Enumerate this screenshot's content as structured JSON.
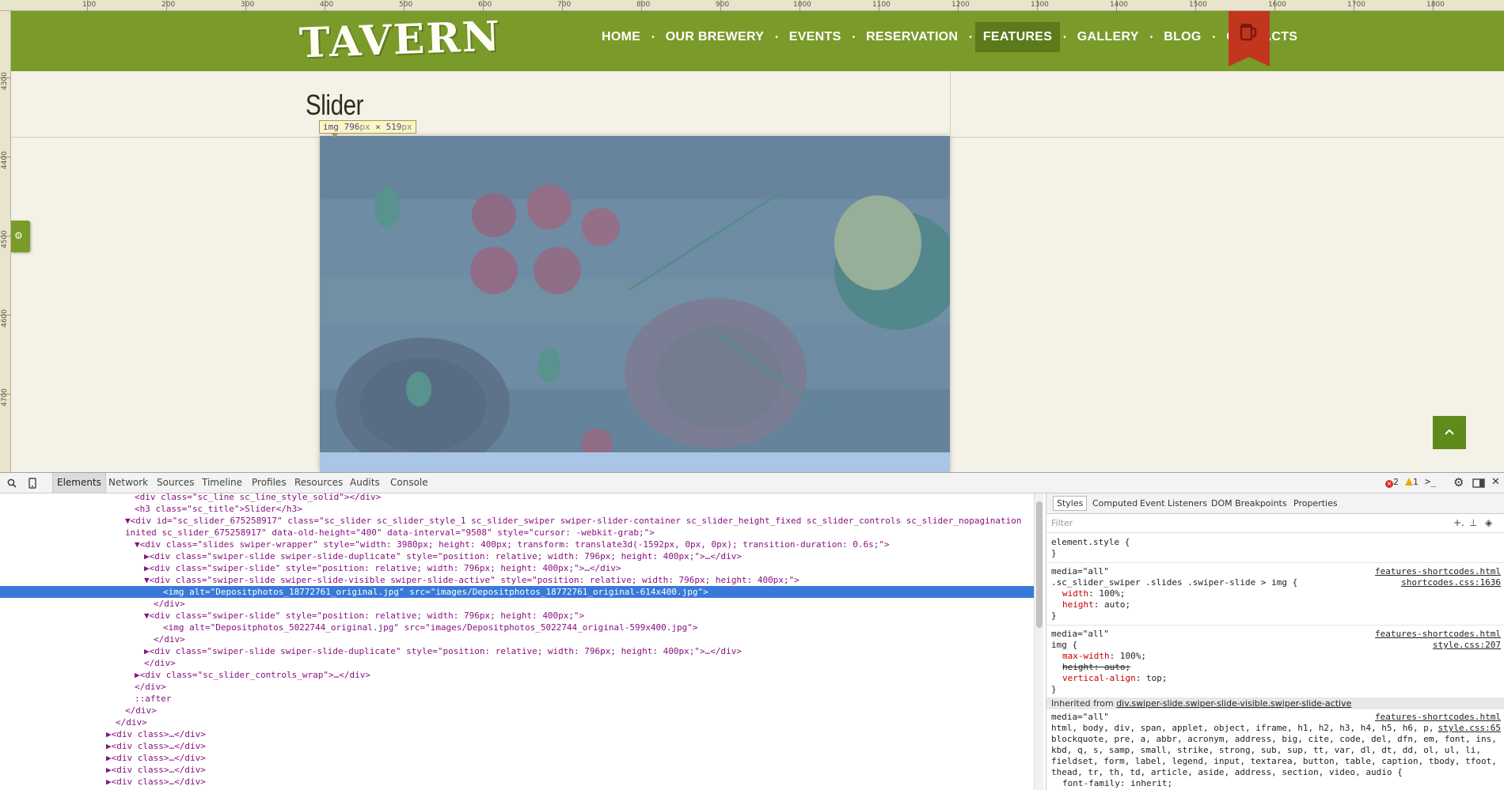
{
  "rulers": {
    "top_labels": [
      "100",
      "200",
      "300",
      "400",
      "500",
      "600",
      "700",
      "800",
      "900",
      "1000",
      "1100",
      "1200",
      "1300",
      "1400",
      "1500",
      "1600",
      "1700",
      "1800"
    ],
    "left_labels": [
      "4300",
      "4400",
      "4500",
      "4600",
      "4700"
    ]
  },
  "header": {
    "logo_text": "TAVERN",
    "nav_items": [
      "HOME",
      "OUR BREWERY",
      "EVENTS",
      "RESERVATION",
      "FEATURES",
      "GALLERY",
      "BLOG",
      "CONTACTS"
    ],
    "active_item": "FEATURES",
    "ribbon_icon": "beer-mug-icon",
    "brand_green": "#7a9a2a",
    "ribbon_red": "#c2361e"
  },
  "page": {
    "section_title": "Slider",
    "inspect_tooltip": {
      "tag": "img",
      "width": "796",
      "height": "519",
      "unit": "px",
      "times": "×"
    },
    "side_tab_icon": "settings-tab-icon",
    "to_top_icon": "chevron-up-icon",
    "highlight_color": "#6fa8dc"
  },
  "devtools": {
    "toolbar_tabs": [
      "Elements",
      "Network",
      "Sources",
      "Timeline",
      "Profiles",
      "Resources",
      "Audits",
      "Console"
    ],
    "active_tab": "Elements",
    "errors": "2",
    "warnings": "1",
    "dom_lines": [
      "<div class=\"sc_line sc_line_style_solid\"></div>",
      "<h3 class=\"sc_title\">Slider</h3>",
      "▼<div id=\"sc_slider_675258917\" class=\"sc_slider sc_slider_style_1 sc_slider_swiper swiper-slider-container sc_slider_height_fixed sc_slider_controls sc_slider_nopagination",
      "inited sc_slider_675258917\" data-old-height=\"400\" data-interval=\"9508\" style=\"cursor: -webkit-grab;\">",
      "▼<div class=\"slides swiper-wrapper\" style=\"width: 3980px; height: 400px; transform: translate3d(-1592px, 0px, 0px); transition-duration: 0.6s;\">",
      "▶<div class=\"swiper-slide swiper-slide-duplicate\" style=\"position: relative; width: 796px; height: 400px;\">…</div>",
      "▶<div class=\"swiper-slide\" style=\"position: relative; width: 796px; height: 400px;\">…</div>",
      "▼<div class=\"swiper-slide swiper-slide-visible swiper-slide-active\" style=\"position: relative; width: 796px; height: 400px;\">",
      "<img alt=\"Depositphotos_18772761_original.jpg\" src=\"images/Depositphotos_18772761_original-614x400.jpg\">",
      "</div>",
      "▼<div class=\"swiper-slide\" style=\"position: relative; width: 796px; height: 400px;\">",
      "<img alt=\"Depositphotos_5022744_original.jpg\" src=\"images/Depositphotos_5022744_original-599x400.jpg\">",
      "</div>",
      "▶<div class=\"swiper-slide swiper-slide-duplicate\" style=\"position: relative; width: 796px; height: 400px;\">…</div>",
      "</div>",
      "▶<div class=\"sc_slider_controls_wrap\">…</div>",
      "</div>",
      "::after",
      "</div>",
      "</div>",
      "▶<div class>…</div>",
      "▶<div class>…</div>",
      "▶<div class>…</div>",
      "▶<div class>…</div>",
      "▶<div class>…</div>"
    ],
    "styles_tabs": [
      "Styles",
      "Computed",
      "Event Listeners",
      "DOM Breakpoints",
      "Properties"
    ],
    "filter_placeholder": "Filter",
    "rules": {
      "element_style": "element.style {",
      "close": "}",
      "media_all": "media=\"all\"",
      "rule1_selector": ".sc_slider_swiper .slides .swiper-slide > img {",
      "rule1_src_a": "features-shortcodes.html",
      "rule1_src_b": "shortcodes.css:1636",
      "rule1_p1": "width",
      "rule1_v1": "100%;",
      "rule1_p2": "height",
      "rule1_v2": "auto;",
      "rule2_selector": "img {",
      "rule2_src_a": "features-shortcodes.html",
      "rule2_src_b": "style.css:207",
      "rule2_p1": "max-width",
      "rule2_v1": "100%;",
      "rule2_p2": "height: auto;",
      "rule2_p3": "vertical-align",
      "rule2_v3": "top;",
      "inherited_prefix": "Inherited from ",
      "inherited_from": "div.swiper-slide.swiper-slide-visible.swiper-slide-active",
      "rule3_src_a": "features-shortcodes.html",
      "rule3_src_b": "style.css:65",
      "rule3_line1": "html, body, div, span, applet, object, iframe, h1, h2, h3, h4, h5, h6, p,",
      "rule3_line2": "blockquote, pre, a, abbr, acronym, address, big, cite, code, del, dfn, em, font, ins,",
      "rule3_line3": "kbd, q, s, samp, small, strike, strong, sub, sup, tt, var, dl, dt, dd, ol, ul, li,",
      "rule3_line4": "fieldset, form, label, legend, input, textarea, button, table, caption, tbody, tfoot,",
      "rule3_line5": "thead, tr, th, td, article, aside, address, section, video, audio {",
      "rule3_line6": "font-family: inherit;"
    }
  }
}
